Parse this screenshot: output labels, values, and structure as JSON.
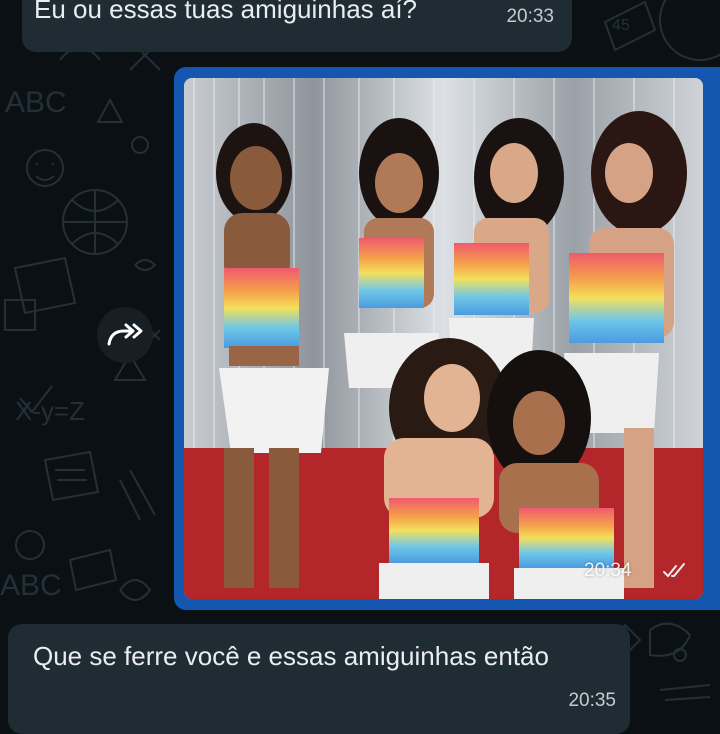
{
  "messages": [
    {
      "direction": "incoming",
      "text": "Eu ou essas tuas amiguinhas aí?",
      "time": "20:33"
    },
    {
      "direction": "outgoing",
      "type": "image",
      "time": "20:34",
      "image_description_icon": "photo-of-six-women",
      "status_icon": "double-check-icon"
    },
    {
      "direction": "incoming",
      "text": "Que se ferre você e essas amiguinhas então",
      "time": "20:35"
    }
  ],
  "icons": {
    "forward": "forward-icon",
    "ticks": "double-check-icon"
  },
  "colors": {
    "background": "#0b1014",
    "incoming_bubble": "#1f2c33",
    "outgoing_bubble": "#1556b0",
    "text": "#e9edef",
    "time": "#c4ccd0"
  }
}
